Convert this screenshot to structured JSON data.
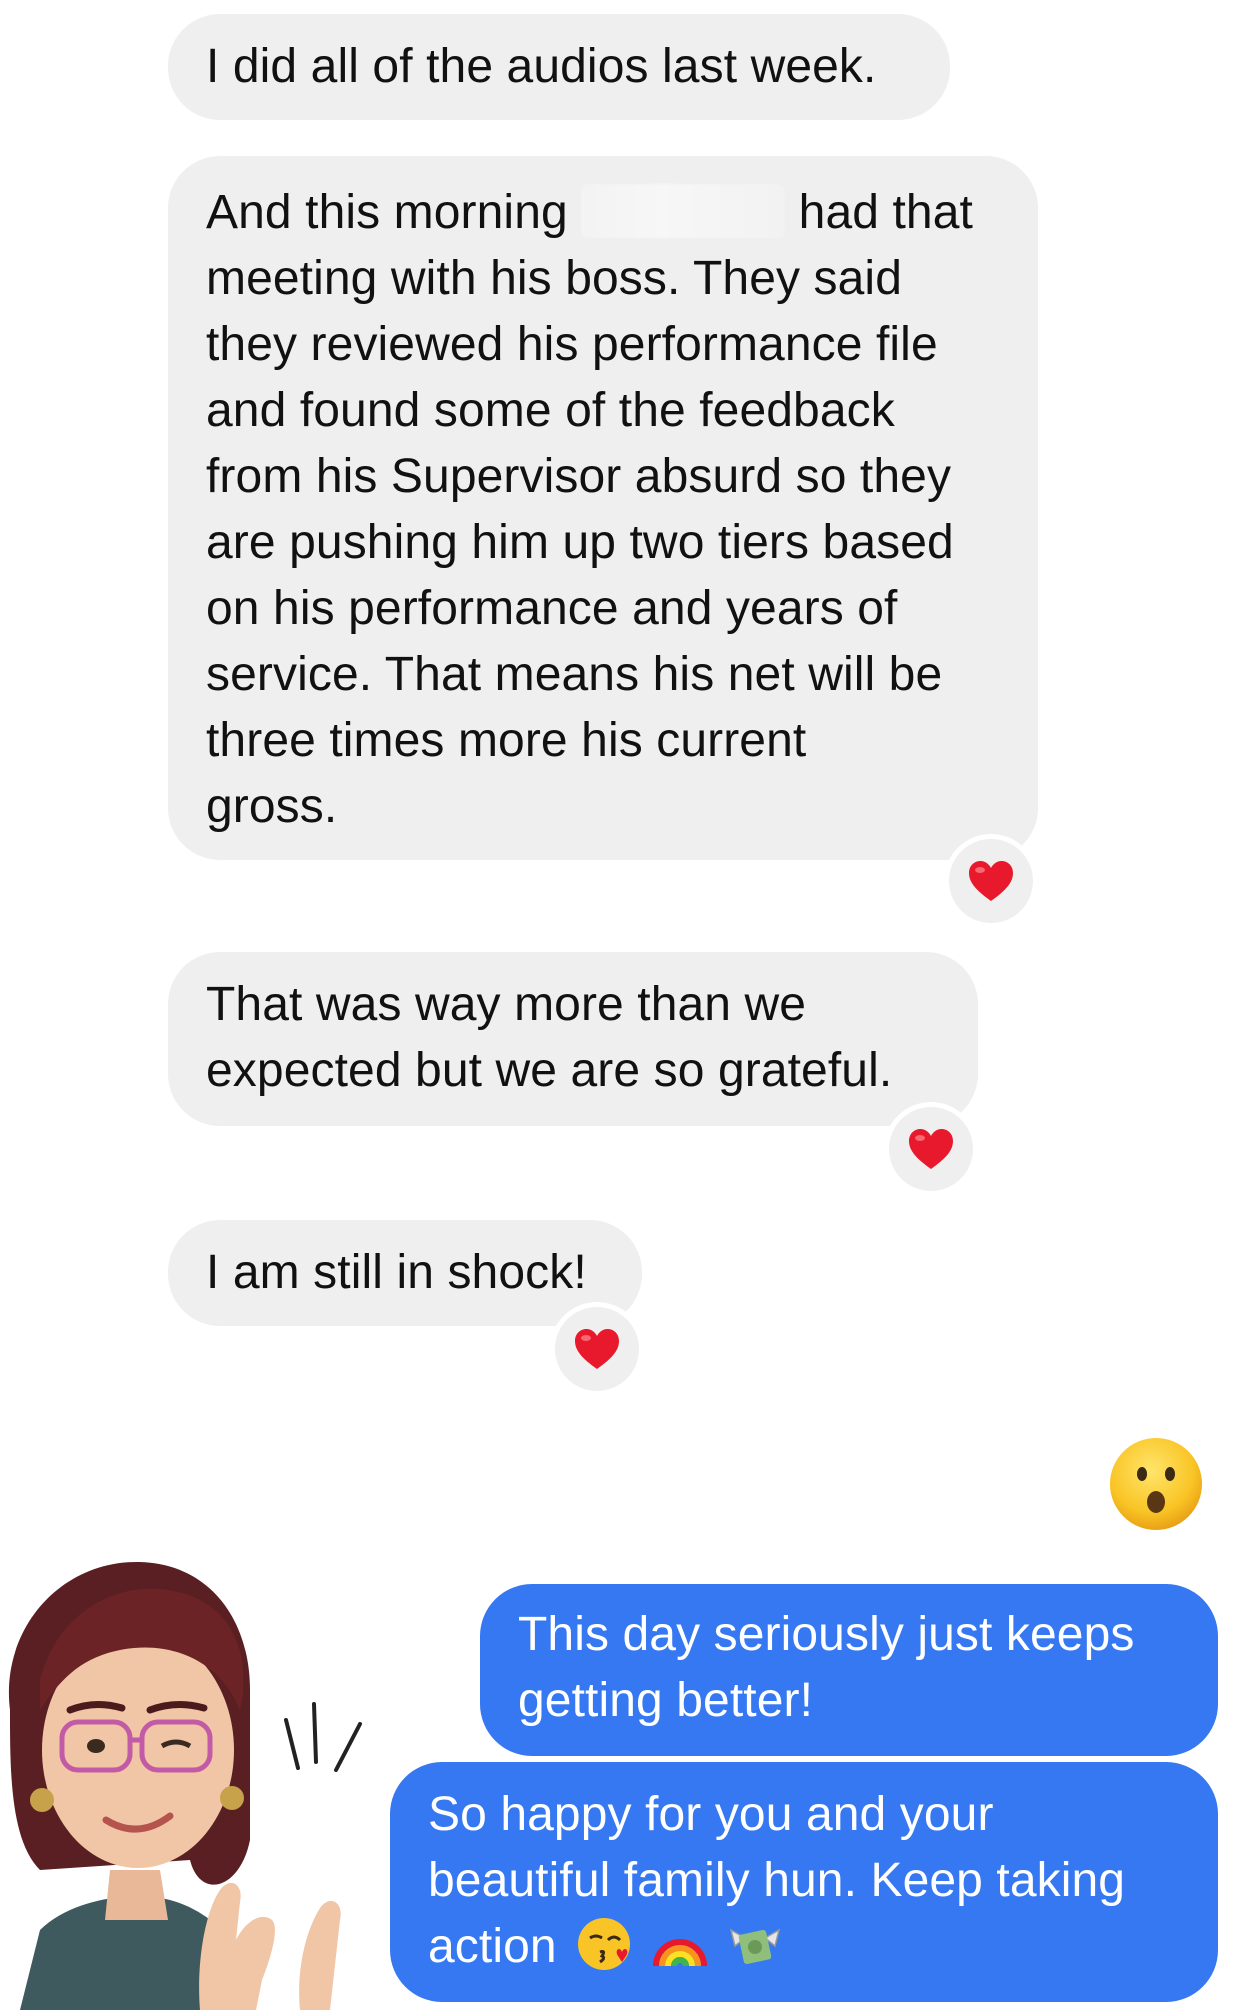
{
  "conversation": {
    "incoming": [
      {
        "lines": [
          "I did all of the audios last week."
        ]
      },
      {
        "lines": [
          "And this morning",
          "had that",
          "meeting with his boss. They said",
          "they reviewed his performance file",
          "and found some of the feedback",
          "from his Supervisor absurd so they",
          "are pushing him up two tiers based",
          "on his performance and years of",
          "service. That means his net will be",
          "three times more his current",
          "gross."
        ],
        "reaction": "heart"
      },
      {
        "lines": [
          "That was way more than we",
          "expected but we are so grateful."
        ],
        "reaction": "heart"
      },
      {
        "lines": [
          "I am still in shock!"
        ],
        "reaction": "heart"
      }
    ],
    "outgoing": [
      {
        "lines": [
          "This day seriously just keeps",
          "getting better!"
        ]
      },
      {
        "lines": [
          "So happy for you and your",
          "beautiful family hun. Keep taking",
          "action"
        ],
        "trailing_emoji": [
          "kissing-face-emoji",
          "rainbow-emoji",
          "money-with-wings-emoji"
        ]
      }
    ],
    "standalone_reaction": "astonished-face-emoji",
    "sticker": "memoji-avatar-sticker"
  },
  "colors": {
    "incoming_bubble": "#efefef",
    "outgoing_bubble": "#3578f2",
    "heart": "#e8192c"
  }
}
